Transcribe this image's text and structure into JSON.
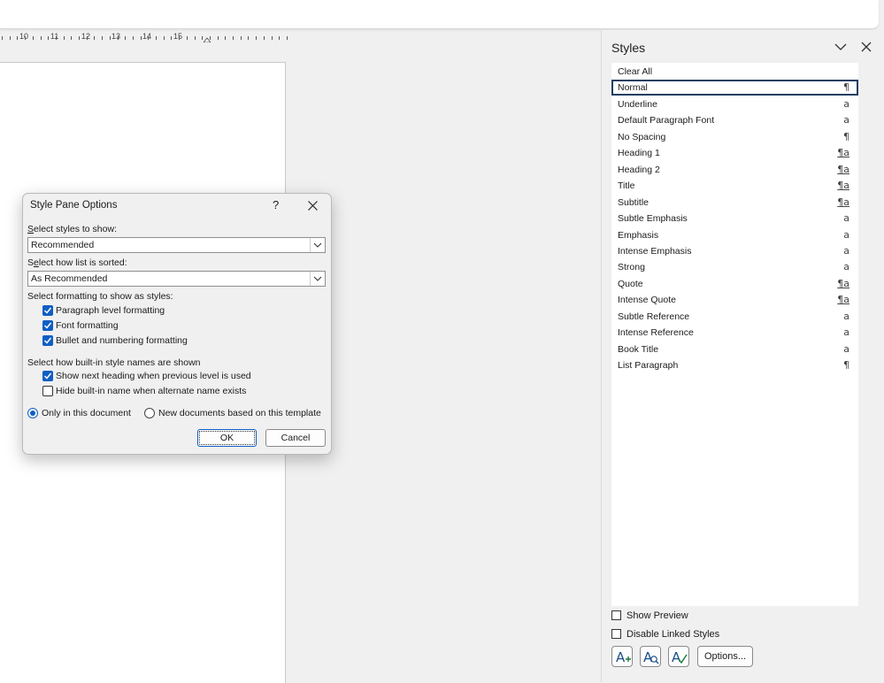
{
  "ruler": {
    "labels": [
      "10",
      "11",
      "12",
      "13",
      "14",
      "15"
    ]
  },
  "styles_pane": {
    "title": "Styles",
    "items": [
      {
        "name": "Clear All",
        "glyph": ""
      },
      {
        "name": "Normal",
        "glyph": "¶"
      },
      {
        "name": "Underline",
        "glyph": "a"
      },
      {
        "name": "Default Paragraph Font",
        "glyph": "a"
      },
      {
        "name": "No Spacing",
        "glyph": "¶"
      },
      {
        "name": "Heading 1",
        "glyph": "¶a"
      },
      {
        "name": "Heading 2",
        "glyph": "¶a"
      },
      {
        "name": "Title",
        "glyph": "¶a"
      },
      {
        "name": "Subtitle",
        "glyph": "¶a"
      },
      {
        "name": "Subtle Emphasis",
        "glyph": "a"
      },
      {
        "name": "Emphasis",
        "glyph": "a"
      },
      {
        "name": "Intense Emphasis",
        "glyph": "a"
      },
      {
        "name": "Strong",
        "glyph": "a"
      },
      {
        "name": "Quote",
        "glyph": "¶a"
      },
      {
        "name": "Intense Quote",
        "glyph": "¶a"
      },
      {
        "name": "Subtle Reference",
        "glyph": "a"
      },
      {
        "name": "Intense Reference",
        "glyph": "a"
      },
      {
        "name": "Book Title",
        "glyph": "a"
      },
      {
        "name": "List Paragraph",
        "glyph": "¶"
      }
    ],
    "selected": "Normal",
    "show_preview_label": "Show Preview",
    "show_preview_checked": false,
    "disable_linked_label": "Disable Linked Styles",
    "disable_linked_checked": false,
    "options_label": "Options..."
  },
  "dialog": {
    "title": "Style Pane Options",
    "help": "?",
    "styles_to_show_label": "Select styles to show:",
    "styles_to_show_value": "Recommended",
    "sort_label": "Select how list is sorted:",
    "sort_value": "As Recommended",
    "formatting_label": "Select formatting to show as styles:",
    "paragraph_formatting": "Paragraph level formatting",
    "font_formatting": "Font formatting",
    "bullet_formatting": "Bullet and numbering formatting",
    "builtin_label": "Select how built-in style names are shown",
    "show_next_heading": "Show next heading when previous level is used",
    "hide_builtin": "Hide built-in name when alternate name exists",
    "only_this_document": "Only in this document",
    "new_documents": "New documents based on this template",
    "ok": "OK",
    "cancel": "Cancel"
  },
  "colors": {
    "accent": "#0f5ec4",
    "selection_border": "#1f3e63"
  }
}
